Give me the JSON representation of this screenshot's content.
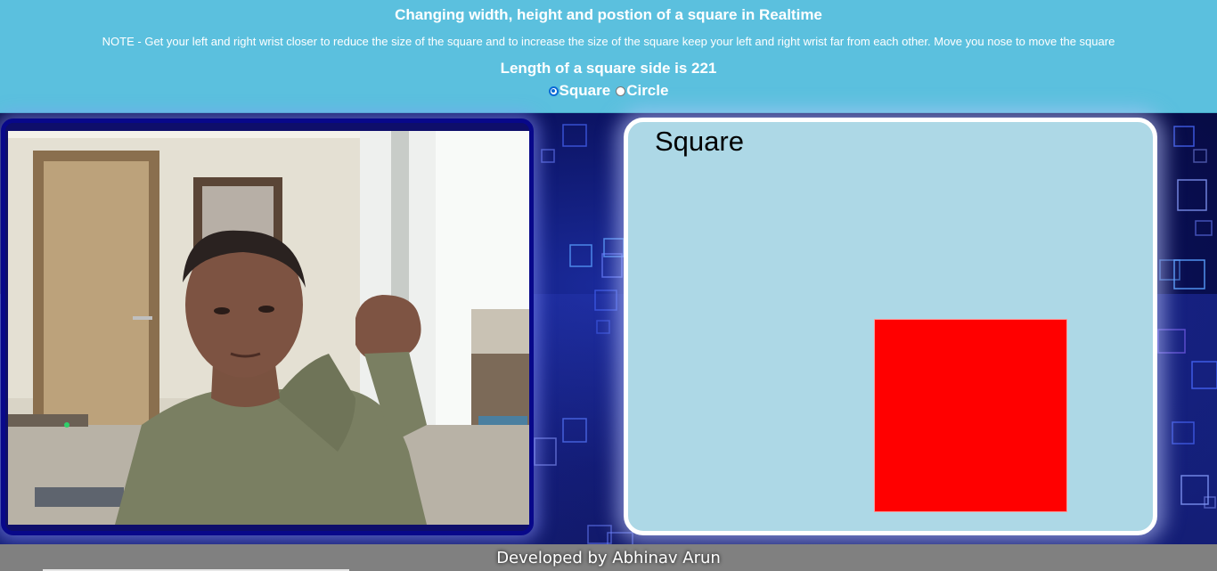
{
  "header": {
    "title": "Changing width, height and postion of a square in Realtime",
    "note": "NOTE - Get your left and right wrist closer to reduce the size of the square and to increase the size of the square keep your left and right wrist far from each other. Move you nose to move the square",
    "side_length_text": "Length of a square side is 221",
    "shape_options": [
      {
        "label": "Square",
        "checked": true
      },
      {
        "label": "Circle",
        "checked": false
      }
    ]
  },
  "canvas": {
    "shape_label": "Square",
    "shape_color": "#ff0000",
    "background_color": "#add8e6"
  },
  "footer": {
    "credit": "Developed by Abhinav Arun"
  },
  "colors": {
    "header_bg": "#5bc0de",
    "webcam_border": "#08088a",
    "footer_bg": "#808080"
  }
}
